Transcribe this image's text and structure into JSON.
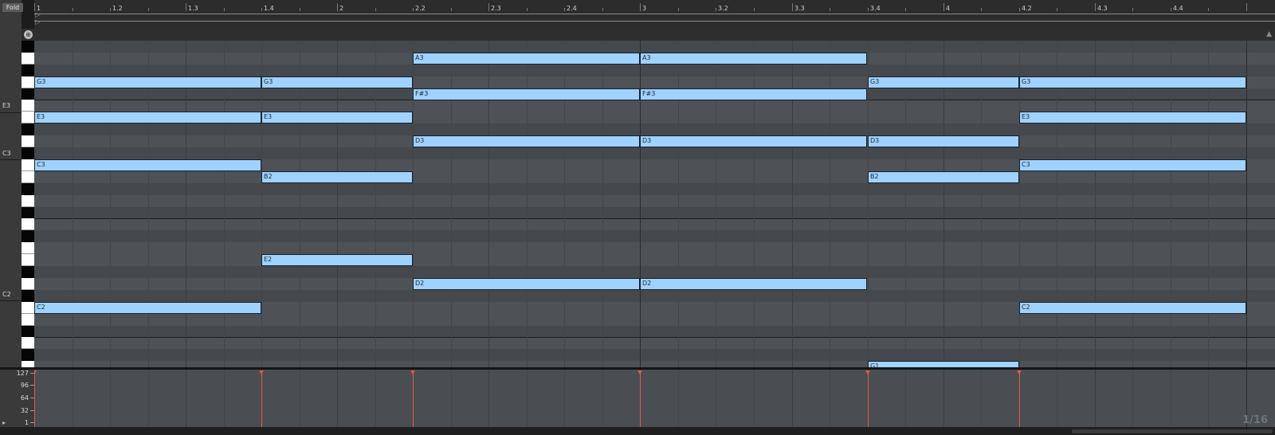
{
  "fold_label": "Fold",
  "octave_labels": [
    "E3",
    "C3",
    "C2"
  ],
  "ruler_labels": [
    "1",
    "1.2",
    "1.3",
    "1.4",
    "2",
    "2.2",
    "2.3",
    "2.4",
    "3",
    "3.2",
    "3.3",
    "3.4",
    "4",
    "4.2",
    "4.3",
    "4.4"
  ],
  "notes": [
    {
      "pitch": "A3",
      "start": 2.5,
      "length": 1.5
    },
    {
      "pitch": "A3",
      "start": 4.0,
      "length": 1.5
    },
    {
      "pitch": "G3",
      "start": 0.0,
      "length": 1.5
    },
    {
      "pitch": "G3",
      "start": 1.5,
      "length": 1.0
    },
    {
      "pitch": "G3",
      "start": 5.5,
      "length": 1.0
    },
    {
      "pitch": "G3",
      "start": 6.5,
      "length": 1.5
    },
    {
      "pitch": "F#3",
      "start": 2.5,
      "length": 1.5
    },
    {
      "pitch": "F#3",
      "start": 4.0,
      "length": 1.5
    },
    {
      "pitch": "E3",
      "start": 0.0,
      "length": 1.5
    },
    {
      "pitch": "E3",
      "start": 1.5,
      "length": 1.0
    },
    {
      "pitch": "E3",
      "start": 6.5,
      "length": 1.5
    },
    {
      "pitch": "D3",
      "start": 2.5,
      "length": 1.5
    },
    {
      "pitch": "D3",
      "start": 4.0,
      "length": 1.5
    },
    {
      "pitch": "D3",
      "start": 5.5,
      "length": 1.0
    },
    {
      "pitch": "C3",
      "start": 0.0,
      "length": 1.5
    },
    {
      "pitch": "C3",
      "start": 6.5,
      "length": 1.5
    },
    {
      "pitch": "B2",
      "start": 1.5,
      "length": 1.0
    },
    {
      "pitch": "B2",
      "start": 5.5,
      "length": 1.0
    },
    {
      "pitch": "E2",
      "start": 1.5,
      "length": 1.0
    },
    {
      "pitch": "D2",
      "start": 2.5,
      "length": 1.5
    },
    {
      "pitch": "D2",
      "start": 4.0,
      "length": 1.5
    },
    {
      "pitch": "C2",
      "start": 0.0,
      "length": 1.5
    },
    {
      "pitch": "C2",
      "start": 6.5,
      "length": 1.5
    },
    {
      "pitch": "G1",
      "start": 5.5,
      "length": 1.0
    }
  ],
  "velocity": {
    "axis_labels": [
      "127",
      "96",
      "64",
      "32",
      "1"
    ],
    "marker_positions": [
      0.0,
      1.5,
      2.5,
      4.0,
      5.5,
      6.5
    ],
    "values": [
      127,
      127,
      127,
      127,
      127,
      127
    ]
  },
  "grid_value": "1/16",
  "icons": {
    "locator": "target-icon",
    "scroll_up": "triangle-up-icon",
    "velocity_lane": "triangle-right-icon"
  },
  "colors": {
    "note_fill": "#9fd2ff",
    "velocity_marker": "#e8574a",
    "grid_light": "#4e5155",
    "grid_dark": "#45484c"
  }
}
